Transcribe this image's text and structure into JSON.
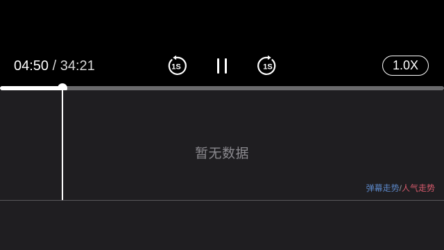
{
  "player": {
    "current_time": "04:50",
    "separator": " / ",
    "total_time": "34:21",
    "rewind_label": "1S",
    "forward_label": "1S",
    "speed_label": "1.0X",
    "progress_fraction": 0.1407
  },
  "trend": {
    "empty_text": "暂无数据",
    "legend_danmaku": "弹幕走势",
    "legend_separator": "/",
    "legend_popularity": "人气走势"
  },
  "colors": {
    "background": "#000000",
    "panel_background": "#1f1e21",
    "progress_played": "#ffffff",
    "progress_track": "#6a6a6c",
    "empty_text": "#8b8a8f",
    "danmaku_trend": "#5b86c6",
    "popularity_trend": "#d75a6c"
  },
  "icons": {
    "rewind": "rewind-1s-icon",
    "pause": "pause-icon",
    "forward": "forward-1s-icon"
  }
}
